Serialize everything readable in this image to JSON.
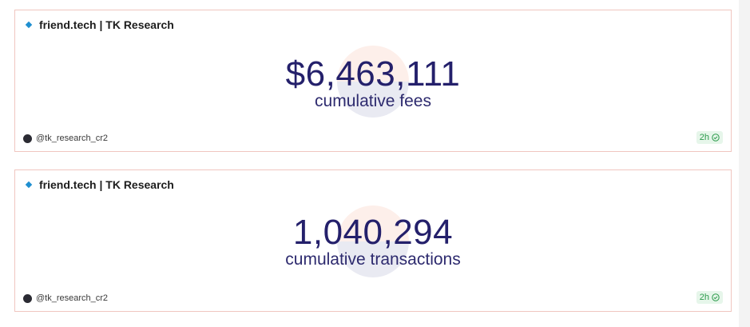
{
  "cards": [
    {
      "title": "friend.tech | TK Research",
      "value": "$6,463,111",
      "label": "cumulative fees",
      "author": "@tk_research_cr2",
      "freshness": "2h"
    },
    {
      "title": "friend.tech | TK Research",
      "value": "1,040,294",
      "label": "cumulative transactions",
      "author": "@tk_research_cr2",
      "freshness": "2h"
    }
  ],
  "icons": {
    "title_marker": "diamond-icon",
    "status": "check-circle-icon",
    "watermark": "logo-watermark"
  },
  "colors": {
    "value_text": "#24206b",
    "card_border": "#f0c6c0",
    "title_marker": "#1f8fd0",
    "status_text": "#2c9a4b",
    "status_bg": "#e6f6ea"
  }
}
